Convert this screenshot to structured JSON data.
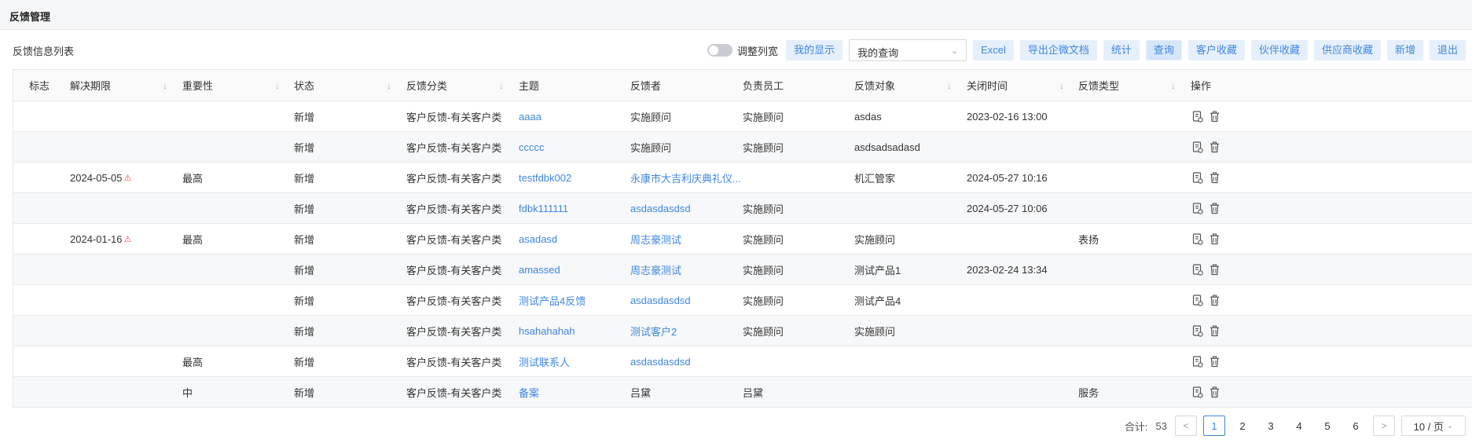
{
  "header": {
    "title": "反馈管理"
  },
  "toolbar": {
    "list_title": "反馈信息列表",
    "toggle_label": "调整列宽",
    "my_display": "我的显示",
    "query_select": "我的查询",
    "buttons": {
      "excel": "Excel",
      "export_doc": "导出企微文档",
      "stats": "统计",
      "query": "查询",
      "customer_fav": "客户收藏",
      "partner_fav": "伙伴收藏",
      "supplier_fav": "供应商收藏",
      "add": "新增",
      "exit": "退出"
    }
  },
  "table": {
    "columns": [
      "标志",
      "解决期限",
      "重要性",
      "状态",
      "反馈分类",
      "主题",
      "反馈者",
      "负责员工",
      "反馈对象",
      "关闭时间",
      "反馈类型",
      "操作"
    ],
    "rows": [
      {
        "flag": "",
        "deadline": "",
        "importance": "",
        "status": "新增",
        "category": "客户反馈-有关客户类",
        "subject": "aaaa",
        "reporter": "实施顾问",
        "staff": "实施顾问",
        "target": "asdas",
        "close_time": "2023-02-16 13:00",
        "type": ""
      },
      {
        "flag": "",
        "deadline": "",
        "importance": "",
        "status": "新增",
        "category": "客户反馈-有关客户类",
        "subject": "ccccc",
        "reporter": "实施顾问",
        "staff": "实施顾问",
        "target": "asdsadsadasd",
        "close_time": "",
        "type": ""
      },
      {
        "flag": "",
        "deadline": "2024-05-05",
        "importance": "最高",
        "status": "新增",
        "category": "客户反馈-有关客户类",
        "subject": "testfdbk002",
        "reporter": "永康市大吉利庆典礼仪...",
        "staff": "",
        "target": "机汇管家",
        "close_time": "2024-05-27 10:16",
        "type": ""
      },
      {
        "flag": "",
        "deadline": "",
        "importance": "",
        "status": "新增",
        "category": "客户反馈-有关客户类",
        "subject": "fdbk111111",
        "reporter": "asdasdasdsd",
        "staff": "实施顾问",
        "target": "",
        "close_time": "2024-05-27 10:06",
        "type": ""
      },
      {
        "flag": "",
        "deadline": "2024-01-16",
        "importance": "最高",
        "status": "新增",
        "category": "客户反馈-有关客户类",
        "subject": "asadasd",
        "reporter": "周志豪测试",
        "staff": "实施顾问",
        "target": "实施顾问",
        "close_time": "",
        "type": "表扬"
      },
      {
        "flag": "",
        "deadline": "",
        "importance": "",
        "status": "新增",
        "category": "客户反馈-有关客户类",
        "subject": "amassed",
        "reporter": "周志豪测试",
        "staff": "实施顾问",
        "target": "测试产品1",
        "close_time": "2023-02-24 13:34",
        "type": ""
      },
      {
        "flag": "",
        "deadline": "",
        "importance": "",
        "status": "新增",
        "category": "客户反馈-有关客户类",
        "subject": "测试产品4反馈",
        "reporter": "asdasdasdsd",
        "staff": "实施顾问",
        "target": "测试产品4",
        "close_time": "",
        "type": ""
      },
      {
        "flag": "",
        "deadline": "",
        "importance": "",
        "status": "新增",
        "category": "客户反馈-有关客户类",
        "subject": "hsahahahah",
        "reporter": "测试客户2",
        "staff": "实施顾问",
        "target": "实施顾问",
        "close_time": "",
        "type": ""
      },
      {
        "flag": "",
        "deadline": "",
        "importance": "最高",
        "status": "新增",
        "category": "客户反馈-有关客户类",
        "subject": "测试联系人",
        "reporter": "asdasdasdsd",
        "staff": "",
        "target": "",
        "close_time": "",
        "type": ""
      },
      {
        "flag": "",
        "deadline": "",
        "importance": "中",
        "status": "新增",
        "category": "客户反馈-有关客户类",
        "subject": "备案",
        "reporter": "吕黛",
        "staff": "吕黛",
        "target": "",
        "close_time": "",
        "type": "服务"
      }
    ],
    "reporter_is_link": [
      false,
      false,
      true,
      true,
      true,
      true,
      true,
      true,
      true,
      false
    ]
  },
  "pagination": {
    "total_label": "合计:",
    "total": "53",
    "pages": [
      "1",
      "2",
      "3",
      "4",
      "5",
      "6"
    ],
    "current": "1",
    "page_size": "10 / 页"
  },
  "colors": {
    "accent": "#3f86e0",
    "button_bg": "#e6f0fc",
    "warning": "#e74c3c"
  },
  "icons": {
    "edit": "edit-doc-icon",
    "delete": "trash-icon",
    "warning": "warning-triangle-icon",
    "sort": "sort-arrow-icon"
  }
}
